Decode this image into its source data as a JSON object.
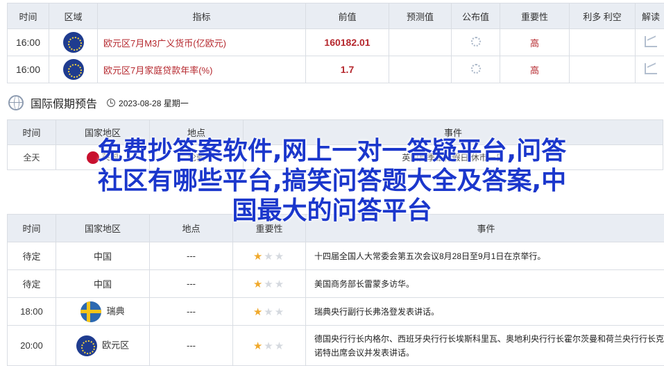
{
  "indicators": {
    "headers": [
      "时间",
      "区域",
      "指标",
      "前值",
      "预测值",
      "公布值",
      "重要性",
      "利多 利空",
      "解读"
    ],
    "rows": [
      {
        "time": "16:00",
        "region_flag": "eu-flag-icon",
        "indicator": "欧元区7月M3广义货币(亿欧元)",
        "previous": "160182.01",
        "forecast": "",
        "actual_icon": "loading-icon",
        "importance": "高",
        "impact": "",
        "chart_icon": "chart-icon"
      },
      {
        "time": "16:00",
        "region_flag": "eu-flag-icon",
        "indicator": "欧元区7月家庭贷款年率(%)",
        "previous": "1.7",
        "forecast": "",
        "actual_icon": "loading-icon",
        "importance": "高",
        "impact": "",
        "chart_icon": "chart-icon"
      }
    ]
  },
  "holiday": {
    "title": "国际假期预告",
    "date": "2023-08-28 星期一",
    "headers": [
      "时间",
      "国家地区",
      "地点",
      "事件"
    ],
    "row": {
      "time": "全天",
      "country": "英国",
      "place": "伦敦",
      "event": "英国夏季银行假日 休市一日"
    }
  },
  "events": {
    "headers": [
      "时间",
      "国家地区",
      "地点",
      "重要性",
      "事件"
    ],
    "rows": [
      {
        "time": "待定",
        "flag": "",
        "country": "中国",
        "place": "---",
        "stars": 1,
        "event": "十四届全国人大常委会第五次会议8月28日至9月1日在京举行。"
      },
      {
        "time": "待定",
        "flag": "",
        "country": "中国",
        "place": "---",
        "stars": 1,
        "event": "美国商务部长雷蒙多访华。"
      },
      {
        "time": "18:00",
        "flag": "se",
        "country": "瑞典",
        "place": "---",
        "stars": 1,
        "event": "瑞典央行副行长弗洛登发表讲话。"
      },
      {
        "time": "20:00",
        "flag": "eu",
        "country": "欧元区",
        "place": "---",
        "stars": 1,
        "event": "德国央行行长内格尔、西班牙央行行长埃斯科里瓦、奥地利央行行长霍尔茨曼和荷兰央行行长克诺特出席会议并发表讲话。"
      }
    ]
  },
  "overlay": {
    "lines": [
      "免费抄答案软件,网上一对一答疑平台,问答",
      "社区有哪些平台,搞笑问答题大全及答案,中",
      "国最大的问答平台"
    ]
  },
  "colors": {
    "accent_red": "#b5272d",
    "overlay_blue": "#1b37cc",
    "header_bg": "#e9edf3",
    "star": "#f0a92c"
  }
}
